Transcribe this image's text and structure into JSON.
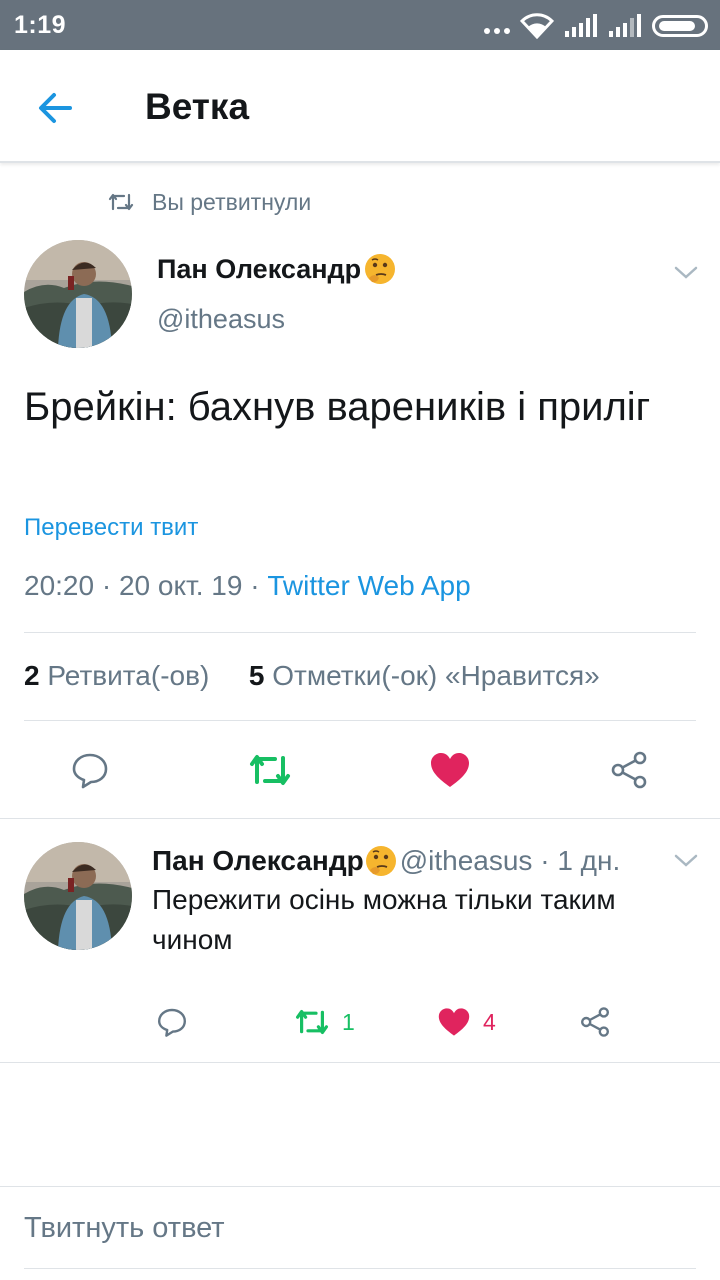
{
  "status_bar": {
    "time": "1:19"
  },
  "header": {
    "title": "Ветка",
    "back_icon": "arrow-left-icon"
  },
  "retweet_context": {
    "text": "Вы ретвитнули",
    "icon": "retweet-icon"
  },
  "main_tweet": {
    "author_name": "Пан Олександр",
    "author_handle": "@itheasus",
    "text": "Брейкін: бахнув вареників і приліг",
    "translate_link": "Перевести твит",
    "time": "20:20",
    "date": "20 окт. 19",
    "source": "Twitter Web App",
    "retweet_count": "2",
    "retweet_label": "Ретвита(-ов)",
    "like_count": "5",
    "like_label": "Отметки(-ок) «Нравится»"
  },
  "reply_tweet": {
    "author_name": "Пан Олександр",
    "meta": "@itheasus · 1 дн.",
    "text": "Пережити осінь можна тільки таким чином",
    "retweet_count": "1",
    "like_count": "4"
  },
  "compose": {
    "placeholder": "Твитнуть ответ"
  },
  "colors": {
    "status_bar": "#67727d",
    "accent_blue": "#1b95e0",
    "retweet_green": "#17bf63",
    "like_red": "#e0245e",
    "secondary_text": "#657786",
    "divider": "#dfe3e7"
  }
}
